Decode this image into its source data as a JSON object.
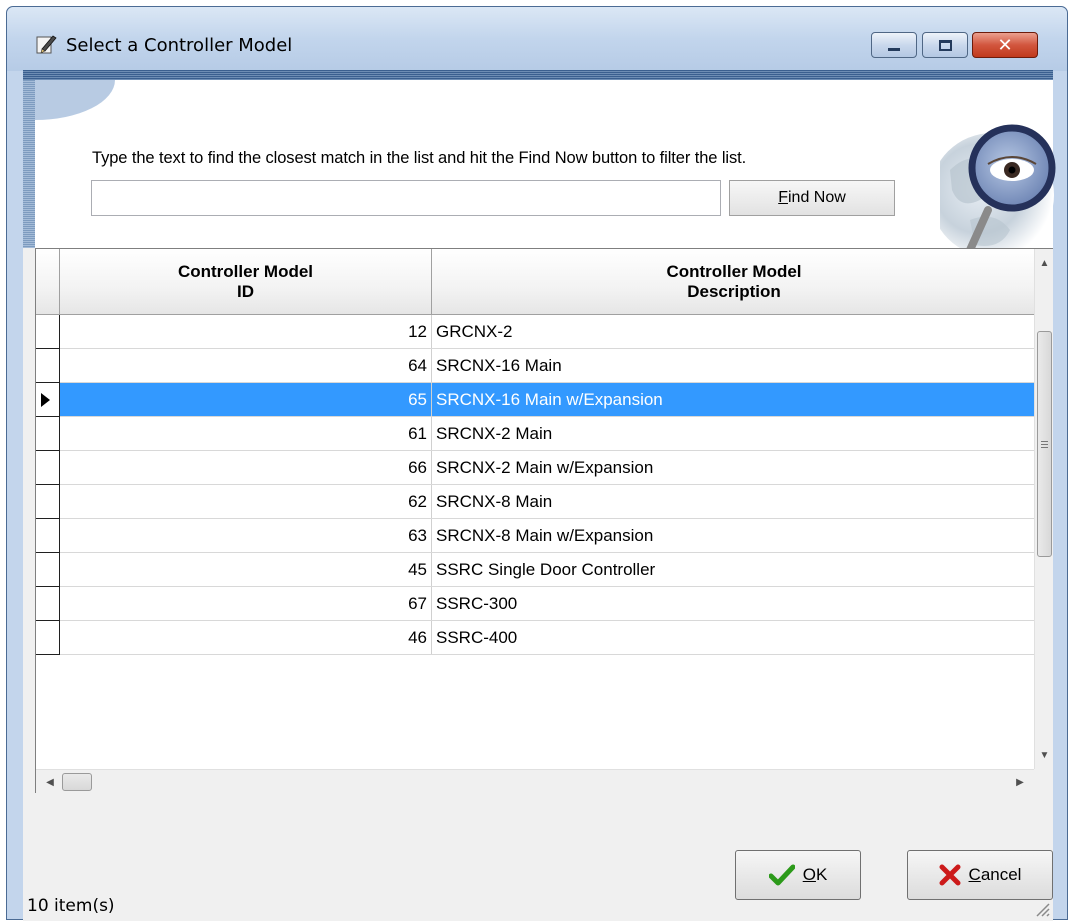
{
  "window": {
    "title": "Select a Controller Model"
  },
  "search": {
    "instruction": "Type the text to find the closest match in the list and hit the Find Now button to filter the list.",
    "value": "",
    "placeholder": "",
    "find_button_prefix": "",
    "find_button_mnemonic": "F",
    "find_button_rest": "ind Now"
  },
  "grid": {
    "columns": [
      {
        "line1": "Controller Model",
        "line2": "ID"
      },
      {
        "line1": "Controller Model",
        "line2": "Description"
      }
    ],
    "selected_row_index": 2,
    "rows": [
      {
        "id": "12",
        "description": "GRCNX-2"
      },
      {
        "id": "64",
        "description": "SRCNX-16 Main"
      },
      {
        "id": "65",
        "description": "SRCNX-16 Main w/Expansion"
      },
      {
        "id": "61",
        "description": "SRCNX-2 Main"
      },
      {
        "id": "66",
        "description": "SRCNX-2 Main w/Expansion"
      },
      {
        "id": "62",
        "description": "SRCNX-8 Main"
      },
      {
        "id": "63",
        "description": "SRCNX-8 Main w/Expansion"
      },
      {
        "id": "45",
        "description": "SSRC Single Door Controller"
      },
      {
        "id": "67",
        "description": "SSRC-300"
      },
      {
        "id": "46",
        "description": "SSRC-400"
      }
    ]
  },
  "buttons": {
    "ok_mnemonic": "O",
    "ok_rest": "K",
    "cancel_mnemonic": "C",
    "cancel_rest": "ancel"
  },
  "status": {
    "text": "10 item(s)"
  },
  "icons": {
    "app": "pen-icon",
    "find": "magnifier-eye-icon",
    "ok": "checkmark-icon",
    "cancel": "x-icon"
  },
  "colors": {
    "selection": "#3399ff",
    "ok_check": "#2c9a1a",
    "cancel_x": "#cc1a1a",
    "close_button": "#c8452a"
  }
}
